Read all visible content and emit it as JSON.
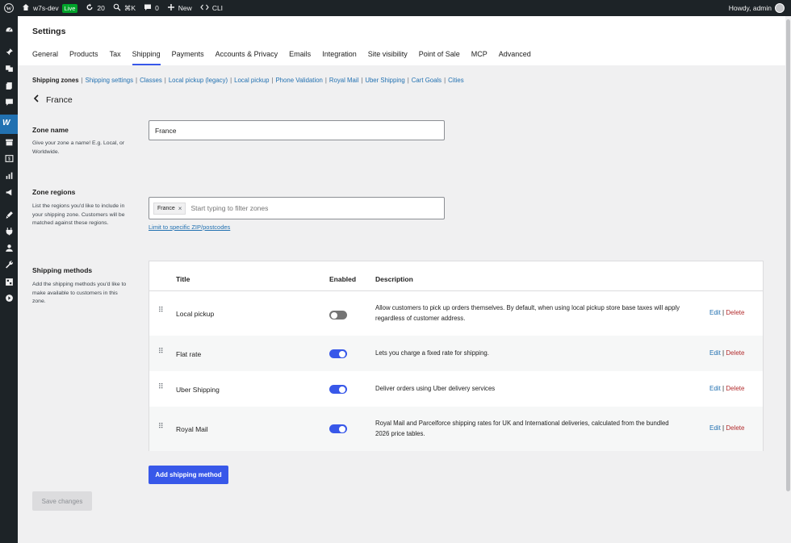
{
  "adminbar": {
    "wp_icon": "wordpress-icon",
    "site_name": "w7s-dev",
    "live_badge": "Live",
    "updates_count": "20",
    "search_shortcut": "⌘K",
    "comments_count": "0",
    "new_label": "New",
    "cli_label": "CLI",
    "howdy": "Howdy, admin"
  },
  "sidebar": {
    "icons": [
      "dashboard-icon",
      "pin-icon",
      "media-icon",
      "pages-icon",
      "comments-icon",
      "woocommerce-icon",
      "products-icon",
      "payments-icon",
      "analytics-icon",
      "marketing-icon",
      "appearance-icon",
      "plugins-icon",
      "users-icon",
      "tools-icon",
      "settings-icon",
      "collapse-icon"
    ]
  },
  "header": {
    "title": "Settings",
    "tabs": [
      {
        "label": "General"
      },
      {
        "label": "Products"
      },
      {
        "label": "Tax"
      },
      {
        "label": "Shipping",
        "active": true
      },
      {
        "label": "Payments"
      },
      {
        "label": "Accounts & Privacy"
      },
      {
        "label": "Emails"
      },
      {
        "label": "Integration"
      },
      {
        "label": "Site visibility"
      },
      {
        "label": "Point of Sale"
      },
      {
        "label": "MCP"
      },
      {
        "label": "Advanced"
      }
    ]
  },
  "subnav": {
    "current": "Shipping zones",
    "links": [
      "Shipping settings",
      "Classes",
      "Local pickup (legacy)",
      "Local pickup",
      "Phone Validation",
      "Royal Mail",
      "Uber Shipping",
      "Cart Goals",
      "Cities"
    ]
  },
  "zone": {
    "back_label": "France",
    "name_title": "Zone name",
    "name_desc": "Give your zone a name! E.g. Local, or Worldwide.",
    "name_value": "France",
    "regions_title": "Zone regions",
    "regions_desc": "List the regions you'd like to include in your shipping zone. Customers will be matched against these regions.",
    "region_chip": "France",
    "regions_placeholder": "Start typing to filter zones",
    "limit_link": "Limit to specific ZIP/postcodes",
    "methods_title": "Shipping methods",
    "methods_desc": "Add the shipping methods you'd like to make available to customers in this zone."
  },
  "methods": {
    "headers": {
      "title": "Title",
      "enabled": "Enabled",
      "description": "Description"
    },
    "edit_label": "Edit",
    "sep": "|",
    "delete_label": "Delete",
    "rows": [
      {
        "title": "Local pickup",
        "enabled": false,
        "description": "Allow customers to pick up orders themselves. By default, when using local pickup store base taxes will apply regardless of customer address."
      },
      {
        "title": "Flat rate",
        "enabled": true,
        "description": "Lets you charge a fixed rate for shipping."
      },
      {
        "title": "Uber Shipping",
        "enabled": true,
        "description": "Deliver orders using Uber delivery services"
      },
      {
        "title": "Royal Mail",
        "enabled": true,
        "description": "Royal Mail and Parcelforce shipping rates for UK and International deliveries, calculated from the bundled 2026 price tables."
      }
    ]
  },
  "buttons": {
    "add_method": "Add shipping method",
    "save": "Save changes"
  },
  "colors": {
    "accent": "#3858e9",
    "link": "#2271b1",
    "delete": "#b32d2e",
    "adminbar": "#1d2327",
    "live": "#00a32a"
  }
}
